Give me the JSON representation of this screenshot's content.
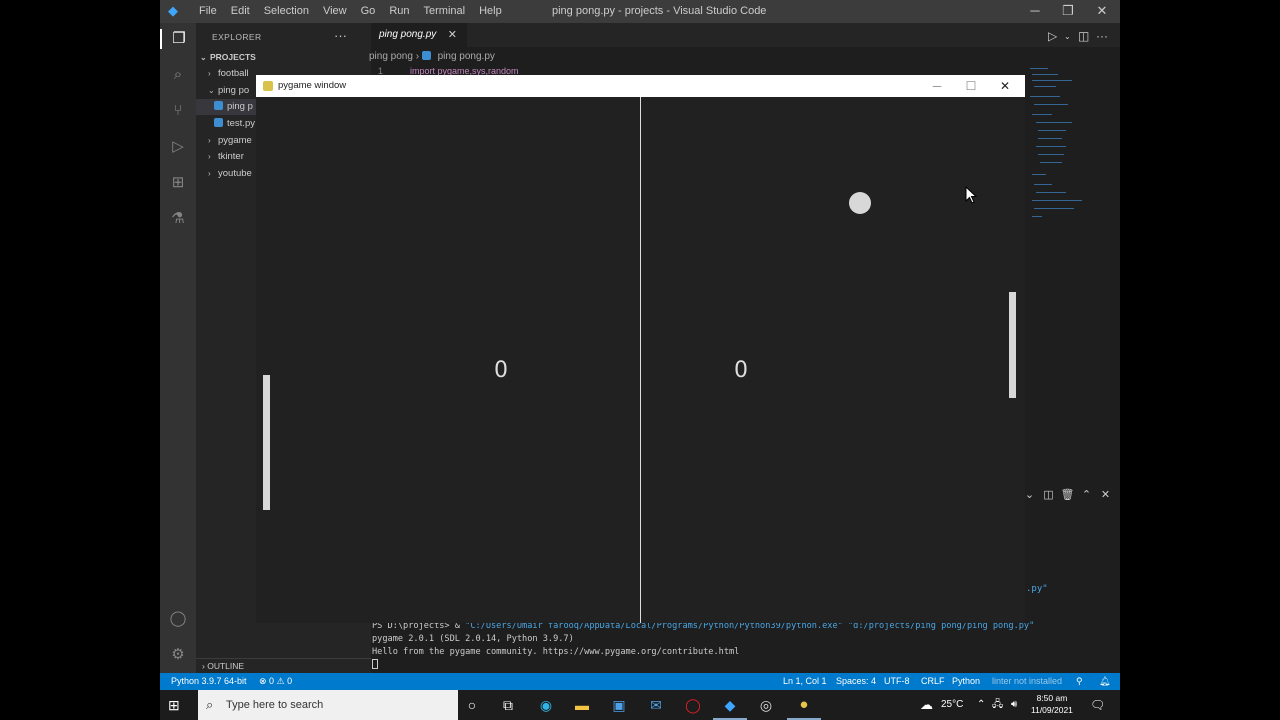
{
  "vscode": {
    "menu": [
      "File",
      "Edit",
      "Selection",
      "View",
      "Go",
      "Run",
      "Terminal",
      "Help"
    ],
    "window_title": "ping pong.py - projects - Visual Studio Code",
    "explorer_label": "EXPLORER",
    "projects_label": "PROJECTS",
    "tree": [
      {
        "label": "football",
        "type": "folder",
        "open": false
      },
      {
        "label": "ping po",
        "type": "folder",
        "open": true
      },
      {
        "label": "ping p",
        "type": "file",
        "selected": true
      },
      {
        "label": "test.py",
        "type": "file",
        "selected": false
      },
      {
        "label": "pygame",
        "type": "folder",
        "open": false
      },
      {
        "label": "tkinter",
        "type": "folder",
        "open": false
      },
      {
        "label": "youtube",
        "type": "folder",
        "open": false
      }
    ],
    "outline_label": "OUTLINE",
    "tab_label": "ping pong.py",
    "breadcrumb": [
      "ping pong",
      "ping pong.py"
    ],
    "code_line_number": "1",
    "code_line_text": "import pygame,sys,random",
    "terminal": {
      "prompt": "PS D:\\projects> & ",
      "exe": "\"C:/Users/Umair farooq/AppData/Local/Programs/Python/Python39/python.exe\" \"d:/projects/ping pong/ping pong.py\"",
      "line2": "pygame 2.0.1 (SDL 2.0.14, Python 3.9.7)",
      "line3": "Hello from the pygame community. https://www.pygame.org/contribute.html",
      "fragment": ".py\""
    },
    "status": {
      "python": "Python 3.9.7 64-bit",
      "problems": "⊗ 0 ⚠ 0",
      "position": "Ln 1, Col 1",
      "spaces": "Spaces: 4",
      "encoding": "UTF-8",
      "eol": "CRLF",
      "language": "Python",
      "lint": "linter not installed"
    },
    "accent": "#007acc"
  },
  "pygame": {
    "title": "pygame window",
    "score_left": "0",
    "score_right": "0"
  },
  "taskbar": {
    "search_placeholder": "Type here to search",
    "weather": "25°C",
    "time": "8:50 am",
    "date": "11/09/2021"
  }
}
